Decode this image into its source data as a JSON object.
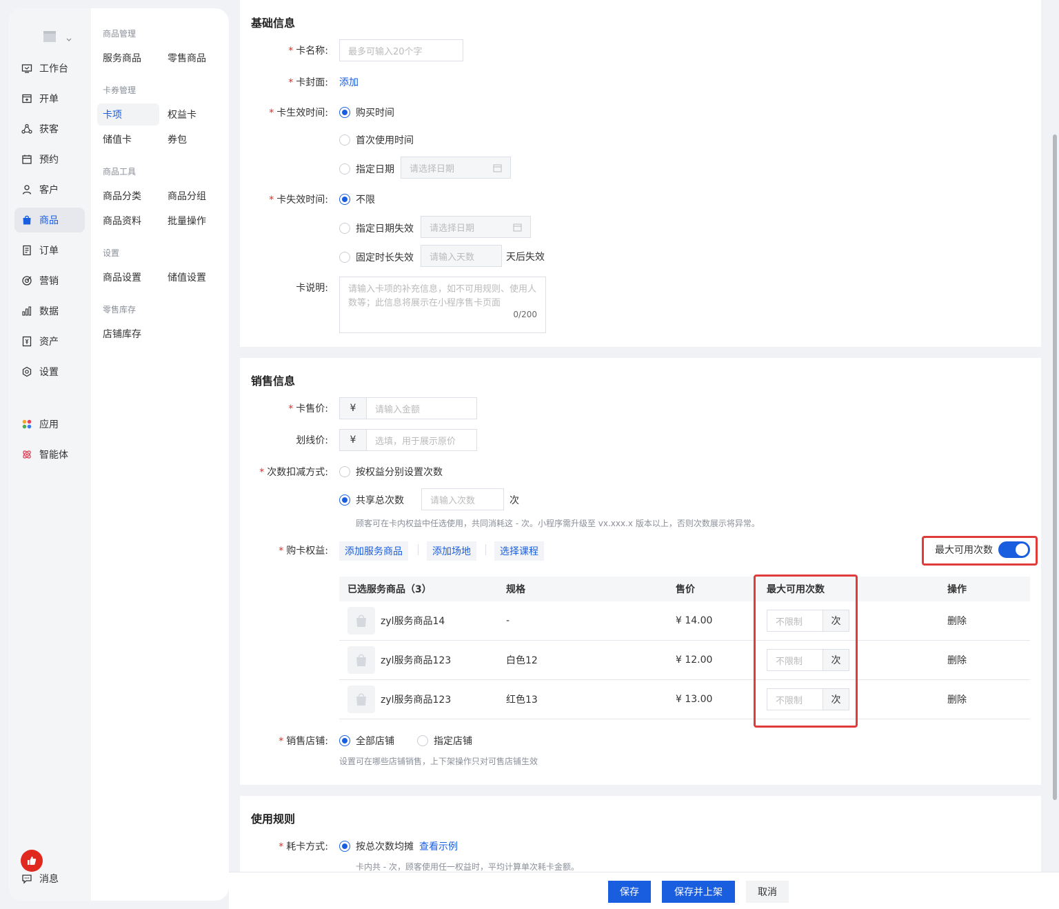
{
  "nav": {
    "items": [
      {
        "label": "工作台",
        "icon": "workbench-icon"
      },
      {
        "label": "开单",
        "icon": "order-create-icon"
      },
      {
        "label": "获客",
        "icon": "acquire-icon"
      },
      {
        "label": "预约",
        "icon": "calendar-icon"
      },
      {
        "label": "客户",
        "icon": "user-icon"
      },
      {
        "label": "商品",
        "icon": "bag-icon"
      },
      {
        "label": "订单",
        "icon": "document-icon"
      },
      {
        "label": "营销",
        "icon": "target-icon"
      },
      {
        "label": "数据",
        "icon": "bar-chart-icon"
      },
      {
        "label": "资产",
        "icon": "asset-icon"
      },
      {
        "label": "设置",
        "icon": "gear-icon"
      },
      {
        "label": "应用",
        "icon": "apps-icon"
      },
      {
        "label": "智能体",
        "icon": "agent-icon"
      }
    ],
    "message_label": "消息",
    "active_color": "#1a5ee0"
  },
  "subnav": {
    "groups": [
      {
        "title": "商品管理",
        "items": [
          "服务商品",
          "零售商品"
        ]
      },
      {
        "title": "卡券管理",
        "items": [
          "卡项",
          "权益卡",
          "储值卡",
          "券包"
        ]
      },
      {
        "title": "商品工具",
        "items": [
          "商品分类",
          "商品分组",
          "商品资料",
          "批量操作"
        ]
      },
      {
        "title": "设置",
        "items": [
          "商品设置",
          "储值设置"
        ]
      },
      {
        "title": "零售库存",
        "items": [
          "店铺库存"
        ]
      }
    ]
  },
  "basic": {
    "title": "基础信息",
    "name_label": "卡名称:",
    "name_placeholder": "最多可输入20个字",
    "cover_label": "卡封面:",
    "cover_link": "添加",
    "start_label": "卡生效时间:",
    "start_options": [
      "购买时间",
      "首次使用时间",
      "指定日期"
    ],
    "date_placeholder": "请选择日期",
    "end_label": "卡失效时间:",
    "end_options": [
      "不限",
      "指定日期失效",
      "固定时长失效"
    ],
    "days_placeholder": "请输入天数",
    "days_suffix": "天后失效",
    "desc_label": "卡说明:",
    "desc_placeholder": "请输入卡项的补充信息，如不可用规则、使用人数等；此信息将展示在小程序售卡页面",
    "desc_count": "0/200"
  },
  "sales": {
    "title": "销售信息",
    "price_label": "卡售价:",
    "price_placeholder": "请输入金额",
    "currency": "¥",
    "strike_label": "划线价:",
    "strike_placeholder": "选填，用于展示原价",
    "deduct_label": "次数扣减方式:",
    "deduct_options": [
      "按权益分别设置次数",
      "共享总次数"
    ],
    "times_placeholder": "请输入次数",
    "times_unit": "次",
    "deduct_hint": "顾客可在卡内权益中任选使用，共同消耗这 - 次。小程序需升级至 vx.xxx.x 版本以上，否则次数展示将异常。",
    "benefit_label": "购卡权益:",
    "benefit_actions": [
      "添加服务商品",
      "添加场地",
      "选择课程"
    ],
    "max_toggle_label": "最大可用次数",
    "table": {
      "headers": [
        "已选服务商品（3）",
        "规格",
        "售价",
        "最大可用次数",
        "操作"
      ],
      "rows": [
        {
          "name": "zyl服务商品14",
          "spec": "-",
          "price": "¥ 14.00",
          "max_placeholder": "不限制",
          "unit": "次",
          "action": "删除"
        },
        {
          "name": "zyl服务商品123",
          "spec": "白色12",
          "price": "¥ 12.00",
          "max_placeholder": "不限制",
          "unit": "次",
          "action": "删除"
        },
        {
          "name": "zyl服务商品123",
          "spec": "红色13",
          "price": "¥ 13.00",
          "max_placeholder": "不限制",
          "unit": "次",
          "action": "删除"
        }
      ]
    },
    "store_label": "销售店铺:",
    "store_options": [
      "全部店铺",
      "指定店铺"
    ],
    "store_hint": "设置可在哪些店铺销售，上下架操作只对可售店铺生效"
  },
  "rules": {
    "title": "使用规则",
    "consume_label": "耗卡方式:",
    "consume_option": "按总次数均摊",
    "consume_link": "查看示例",
    "consume_hint": "卡内共 - 次，顾客使用任一权益时，平均计算单次耗卡金额。"
  },
  "footer": {
    "save": "保存",
    "save_publish": "保存并上架",
    "cancel": "取消"
  },
  "colors": {
    "primary": "#1a5ee0",
    "required": "#e02a20",
    "highlight_box": "#e03b3b"
  }
}
